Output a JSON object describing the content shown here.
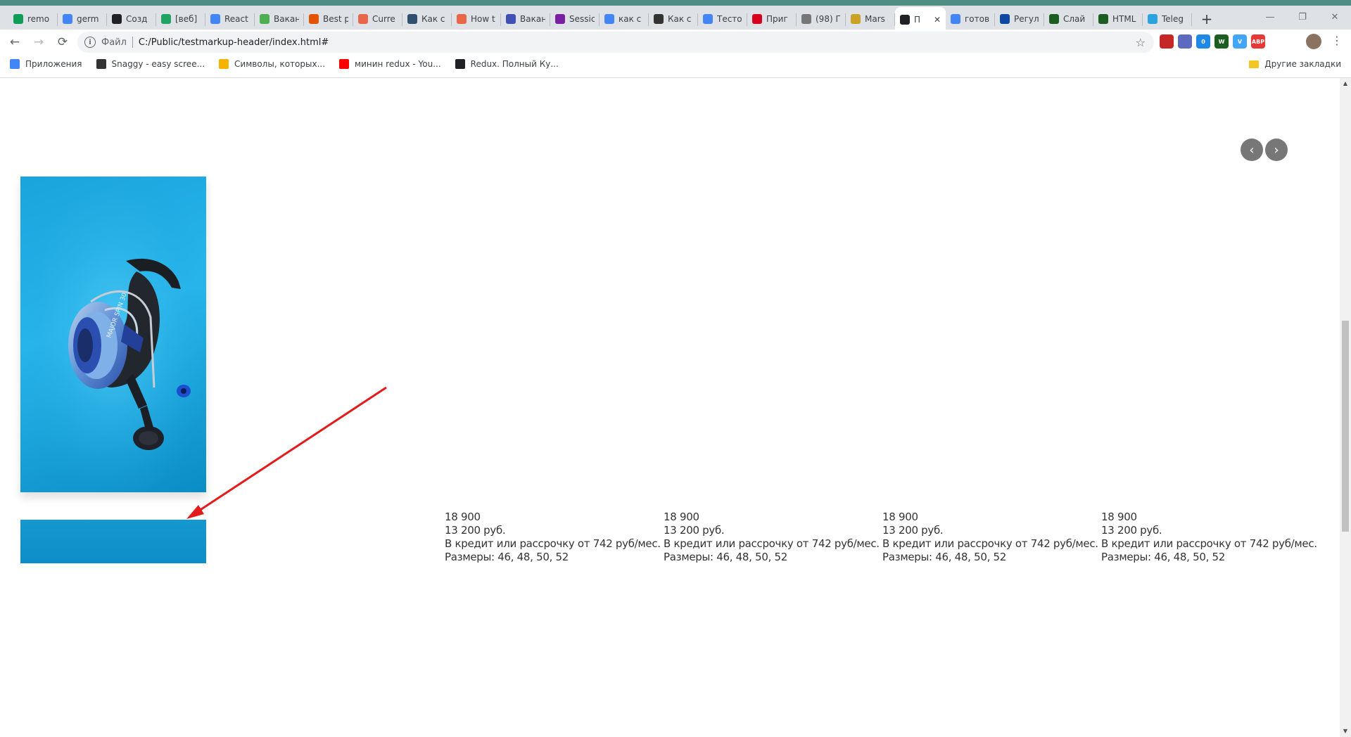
{
  "browser": {
    "tabs": [
      {
        "title": "remo",
        "icon_color": "#0f9d58"
      },
      {
        "title": "germ",
        "icon_color": "#4285f4"
      },
      {
        "title": "Созд",
        "icon_color": "#202124"
      },
      {
        "title": "[веб]",
        "icon_color": "#1fa463"
      },
      {
        "title": "React",
        "icon_color": "#4285f4"
      },
      {
        "title": "Вакан",
        "icon_color": "#4caf50"
      },
      {
        "title": "Best p",
        "icon_color": "#e65100"
      },
      {
        "title": "Curre",
        "icon_color": "#e8664a"
      },
      {
        "title": "Как с",
        "icon_color": "#2f4f6f"
      },
      {
        "title": "How t",
        "icon_color": "#e8664a"
      },
      {
        "title": "Вакан",
        "icon_color": "#3f51b5"
      },
      {
        "title": "Sessic",
        "icon_color": "#7b1fa2"
      },
      {
        "title": "как с",
        "icon_color": "#4285f4"
      },
      {
        "title": "Как с",
        "icon_color": "#333333"
      },
      {
        "title": "Тесто",
        "icon_color": "#4285f4"
      },
      {
        "title": "Приг",
        "icon_color": "#d6001c"
      },
      {
        "title": "(98) Г",
        "icon_color": "#777777"
      },
      {
        "title": "Mars",
        "icon_color": "#c9a227"
      },
      {
        "title": "П",
        "icon_color": "#202124",
        "active": true
      },
      {
        "title": "готов",
        "icon_color": "#4285f4"
      },
      {
        "title": "Регул",
        "icon_color": "#0d47a1"
      },
      {
        "title": "Слай",
        "icon_color": "#1b5e20"
      },
      {
        "title": "HTML",
        "icon_color": "#1b5e20"
      },
      {
        "title": "Teleg",
        "icon_color": "#2aa3df"
      }
    ],
    "active_tab_close": "✕",
    "new_tab": "+",
    "window_controls": {
      "minimize": "—",
      "restore": "❐",
      "close": "✕"
    },
    "toolbar": {
      "back": "←",
      "forward": "→",
      "reload": "⟳",
      "info_icon": "i",
      "scheme_label": "Файл",
      "url": "C:/Public/testmarkup-header/index.html#",
      "star": "☆",
      "menu": "⋮"
    },
    "extensions": [
      {
        "name": "ext-red-icon",
        "color": "#c62828",
        "label": ""
      },
      {
        "name": "ext-circle-icon",
        "color": "#5c6bc0",
        "label": ""
      },
      {
        "name": "ext-badge-icon",
        "color": "#1e88e5",
        "label": "0"
      },
      {
        "name": "ext-w-icon",
        "color": "#1b5e20",
        "label": "W"
      },
      {
        "name": "ext-v-icon",
        "color": "#42a5f5",
        "label": "V"
      },
      {
        "name": "ext-abp-icon",
        "color": "#e53935",
        "label": "ABP"
      }
    ],
    "bookmarks": [
      {
        "label": "Приложения",
        "icon": "apps-grid-icon",
        "color": "#4285f4"
      },
      {
        "label": "Snaggy - easy scree...",
        "icon": "snaggy-icon",
        "color": "#333333"
      },
      {
        "label": "Символы, которых...",
        "icon": "pencil-icon",
        "color": "#f4b400"
      },
      {
        "label": "минин redux - You...",
        "icon": "youtube-icon",
        "color": "#ff0000"
      },
      {
        "label": "Redux. Полный Ку...",
        "icon": "globe-icon",
        "color": "#202124"
      }
    ],
    "other_bookmarks": "Другие закладки"
  },
  "page": {
    "slider": {
      "prev": "‹",
      "next": "›"
    },
    "products": [
      {
        "old_price": "18 900",
        "price": "13 200 руб.",
        "credit": "В кредит или рассрочку от 742 руб/мес.",
        "sizes": "Размеры: 46, 48, 50, 52"
      },
      {
        "old_price": "18 900",
        "price": "13 200 руб.",
        "credit": "В кредит или рассрочку от 742 руб/мес.",
        "sizes": "Размеры: 46, 48, 50, 52"
      },
      {
        "old_price": "18 900",
        "price": "13 200 руб.",
        "credit": "В кредит или рассрочку от 742 руб/мес.",
        "sizes": "Размеры: 46, 48, 50, 52"
      },
      {
        "old_price": "18 900",
        "price": "13 200 руб.",
        "credit": "В кредит или рассрочку от 742 руб/мес.",
        "sizes": "Размеры: 46, 48, 50, 52"
      }
    ],
    "product_image": {
      "label": "MAJOR SPIN 30"
    }
  },
  "colors": {
    "tab_strip": "#dee1e6",
    "accent_strip": "#4f8f83",
    "card_blue": "#1aa4dc",
    "annotation_arrow": "#e21b1b"
  }
}
